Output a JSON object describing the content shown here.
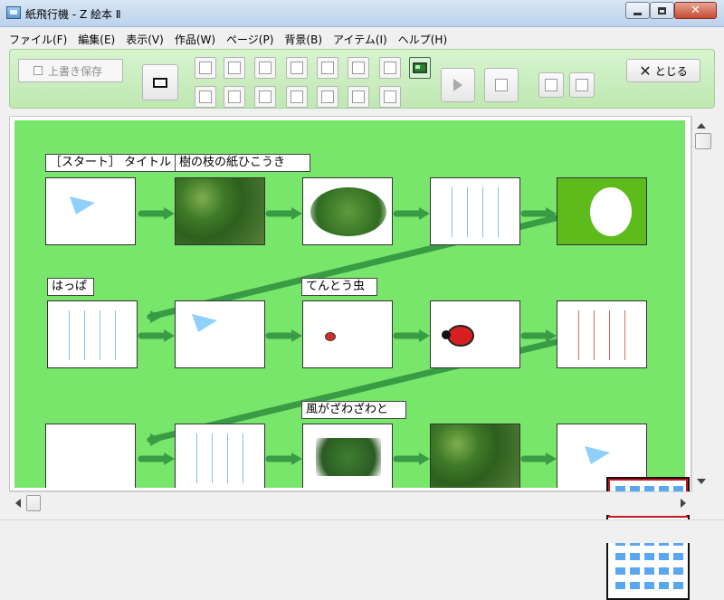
{
  "window": {
    "title": "紙飛行機 - Z 絵本 Ⅱ",
    "buttons": {
      "close_glyph": "✕"
    }
  },
  "menu": [
    "ファイル(F)",
    "編集(E)",
    "表示(V)",
    "作品(W)",
    "ページ(P)",
    "背景(B)",
    "アイテム(I)",
    "ヘルプ(H)"
  ],
  "toolbar": {
    "save_label": "上書き保存",
    "close_label": "とじる",
    "colors": {
      "toolbar_bg": "#cdeec2",
      "board_bg": "#77e66a",
      "accent_green": "#2e7d32"
    }
  },
  "board": {
    "page_titles": {
      "start": "［スタート］ タイトル",
      "row1_second": "樹の枝の紙ひこうき",
      "row2_first": "はっぱ",
      "row2_third": "てんとう虫",
      "row3_third": "風がざわざわと"
    },
    "icons": {
      "paper_plane": "paper-plane-icon",
      "ladybug": "ladybug-icon",
      "forest": "forest-icon"
    }
  }
}
